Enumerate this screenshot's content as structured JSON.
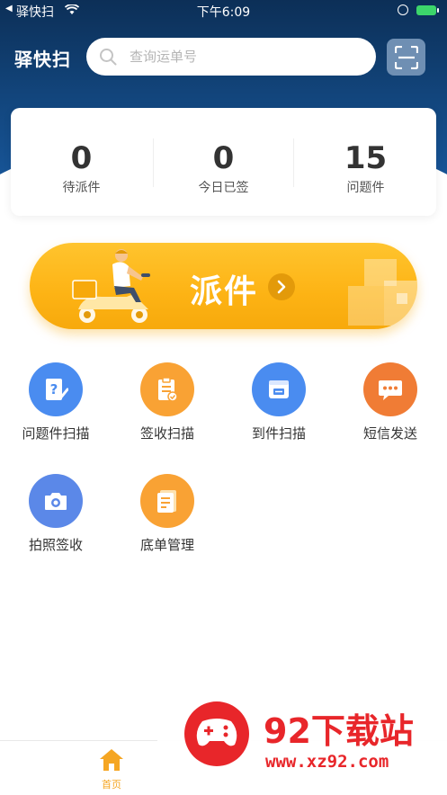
{
  "status_bar": {
    "carrier": "驿快扫",
    "time": "下午6:09"
  },
  "header": {
    "app_title": "驿快扫"
  },
  "search": {
    "placeholder": "查询运单号"
  },
  "stats": [
    {
      "value": "0",
      "label": "待派件"
    },
    {
      "value": "0",
      "label": "今日已签"
    },
    {
      "value": "15",
      "label": "问题件"
    }
  ],
  "dispatch": {
    "label": "派件"
  },
  "grid": [
    {
      "label": "问题件扫描",
      "icon": "question-doc-icon",
      "color": "#4a8cf0"
    },
    {
      "label": "签收扫描",
      "icon": "clipboard-icon",
      "color": "#f9a234"
    },
    {
      "label": "到件扫描",
      "icon": "package-box-icon",
      "color": "#4a8cf0"
    },
    {
      "label": "短信发送",
      "icon": "chat-bubble-icon",
      "color": "#f07c35"
    },
    {
      "label": "拍照签收",
      "icon": "camera-icon",
      "color": "#5b88e8"
    },
    {
      "label": "底单管理",
      "icon": "document-icon",
      "color": "#f9a234"
    }
  ],
  "tabbar": {
    "home_label": "首页"
  },
  "colors": {
    "accent": "#f5a623",
    "header": "#12457c"
  },
  "watermark": {
    "name": "92下载站",
    "url": "www.xz92.com"
  }
}
